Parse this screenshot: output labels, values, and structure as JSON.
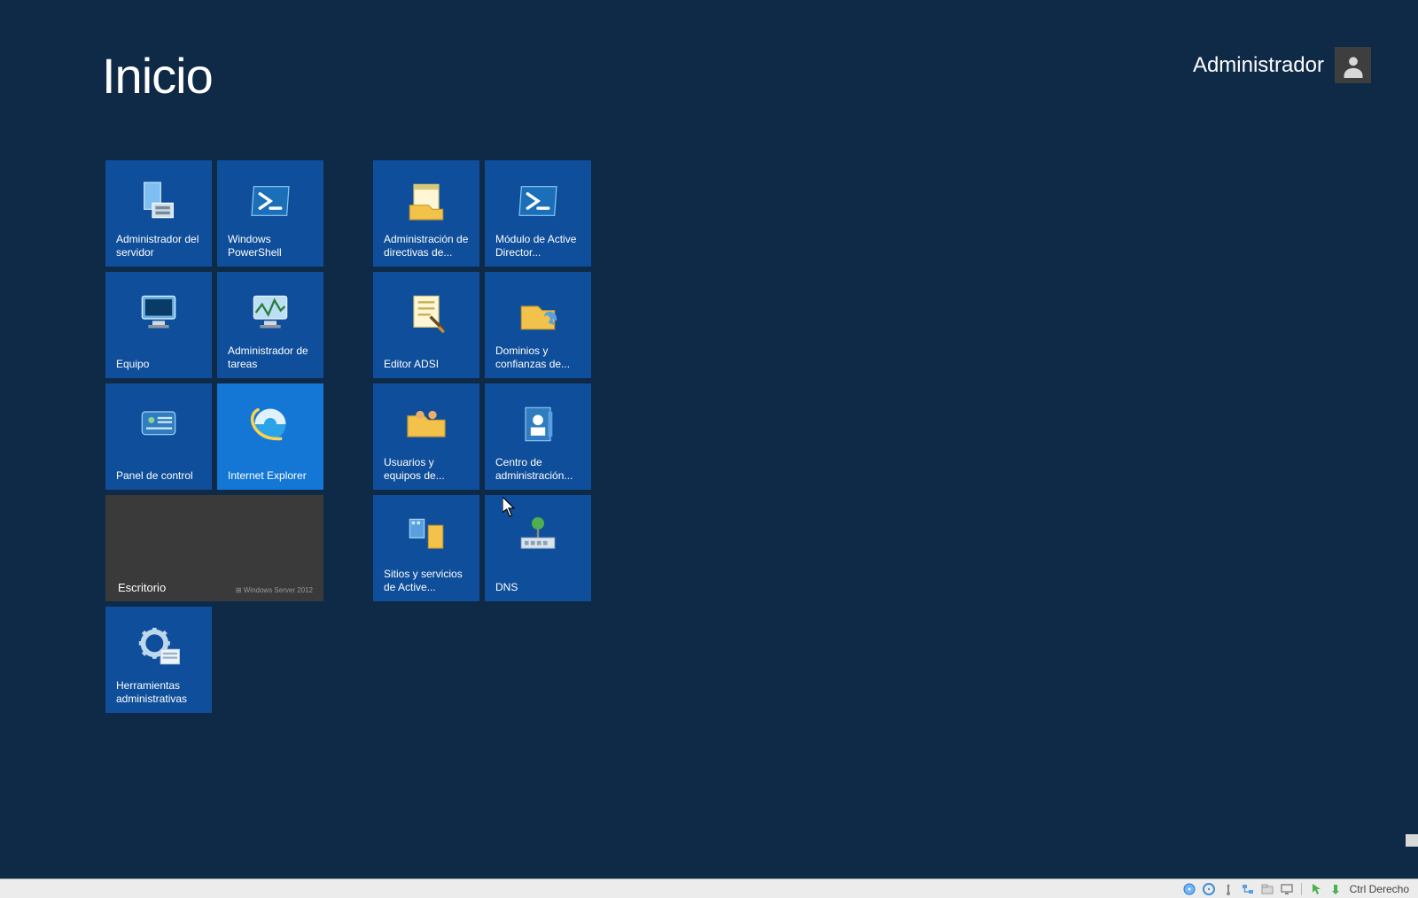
{
  "header": {
    "title": "Inicio",
    "user_name": "Administrador"
  },
  "groups": [
    {
      "tiles": [
        {
          "id": "server-manager",
          "label": "Administrador del servidor",
          "icon": "server-manager-icon"
        },
        {
          "id": "powershell",
          "label": "Windows PowerShell",
          "icon": "powershell-icon"
        },
        {
          "id": "computer",
          "label": "Equipo",
          "icon": "computer-icon"
        },
        {
          "id": "task-manager",
          "label": "Administrador de tareas",
          "icon": "task-manager-icon"
        },
        {
          "id": "control-panel",
          "label": "Panel de control",
          "icon": "control-panel-icon"
        },
        {
          "id": "internet-explorer",
          "label": "Internet Explorer",
          "icon": "ie-icon",
          "bright": true
        },
        {
          "id": "desktop",
          "label": "Escritorio",
          "icon": "desktop-icon",
          "wide": true,
          "watermark": "Windows Server 2012"
        },
        {
          "id": "admin-tools",
          "label": "Herramientas administrativas",
          "icon": "admin-tools-icon"
        }
      ]
    },
    {
      "tiles": [
        {
          "id": "gp-management",
          "label": "Administración de directivas de...",
          "icon": "notepad-folder-icon"
        },
        {
          "id": "ad-powershell-module",
          "label": "Módulo de Active Director...",
          "icon": "powershell-icon"
        },
        {
          "id": "adsi-edit",
          "label": "Editor ADSI",
          "icon": "adsi-icon"
        },
        {
          "id": "ad-domains-trusts",
          "label": "Dominios y confianzas de...",
          "icon": "domains-icon"
        },
        {
          "id": "ad-users-computers",
          "label": "Usuarios y equipos de...",
          "icon": "users-folder-icon"
        },
        {
          "id": "ad-admin-center",
          "label": "Centro de administración...",
          "icon": "ad-center-icon"
        },
        {
          "id": "ad-sites-services",
          "label": "Sitios y servicios de Active...",
          "icon": "sites-icon"
        },
        {
          "id": "dns",
          "label": "DNS",
          "icon": "dns-icon"
        }
      ]
    }
  ],
  "statusbar": {
    "host_key_label": "Ctrl Derecho",
    "icons": [
      "disk-icon",
      "optical-icon",
      "usb-icon",
      "network-icon",
      "shared-folder-icon",
      "display-icon",
      "mouse-capture-icon",
      "keyboard-icon"
    ]
  }
}
